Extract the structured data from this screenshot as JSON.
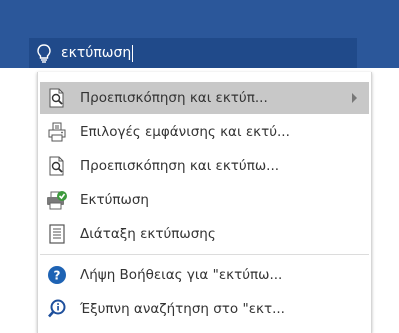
{
  "search": {
    "value": "εκτύπωση",
    "icon": "lightbulb-icon"
  },
  "menu": {
    "items": [
      {
        "label": "Προεπισκόπηση και εκτύπ...",
        "icon": "print-preview-icon",
        "has_submenu": true,
        "highlighted": true
      },
      {
        "label": "Επιλογές εμφάνισης και εκτύ...",
        "icon": "print-options-icon"
      },
      {
        "label": "Προεπισκόπηση και εκτύπω...",
        "icon": "print-preview-icon"
      },
      {
        "label": "Εκτύπωση",
        "icon": "printer-icon"
      },
      {
        "label": "Διάταξη εκτύπωσης",
        "icon": "print-layout-icon"
      },
      {
        "label": "Λήψη Βοήθειας για \"εκτύπω...",
        "icon": "help-icon"
      },
      {
        "label": "Έξυπνη αναζήτηση στο \"εκτ...",
        "icon": "smart-lookup-icon"
      }
    ]
  },
  "colors": {
    "ribbon": "#2b579a",
    "search_box": "#204a8a",
    "highlight": "#c8c8c8",
    "help": "#1e63b4"
  }
}
